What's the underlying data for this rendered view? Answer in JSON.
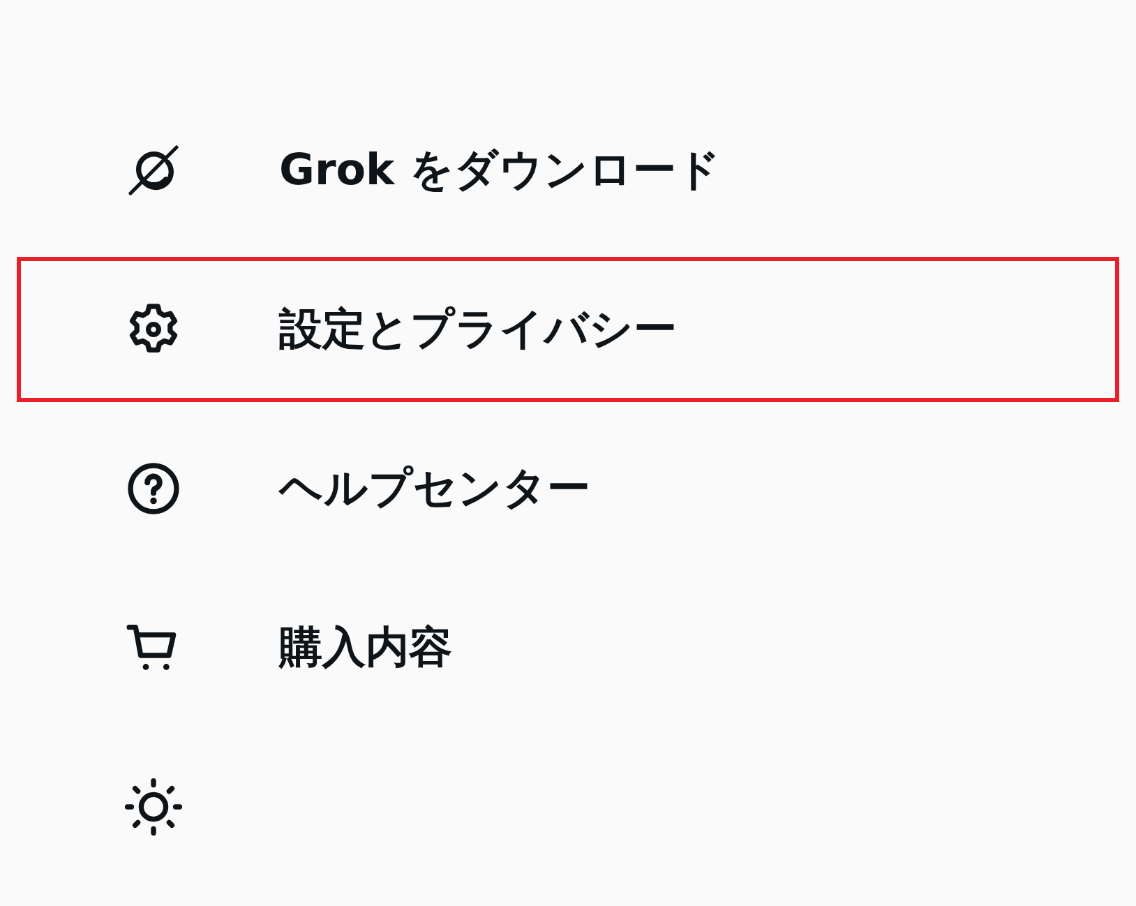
{
  "menu": {
    "items": [
      {
        "label": "Grok をダウンロード",
        "highlighted": false
      },
      {
        "label": "設定とプライバシー",
        "highlighted": true
      },
      {
        "label": "ヘルプセンター",
        "highlighted": false
      },
      {
        "label": "購入内容",
        "highlighted": false
      },
      {
        "highlighted": false
      }
    ]
  }
}
